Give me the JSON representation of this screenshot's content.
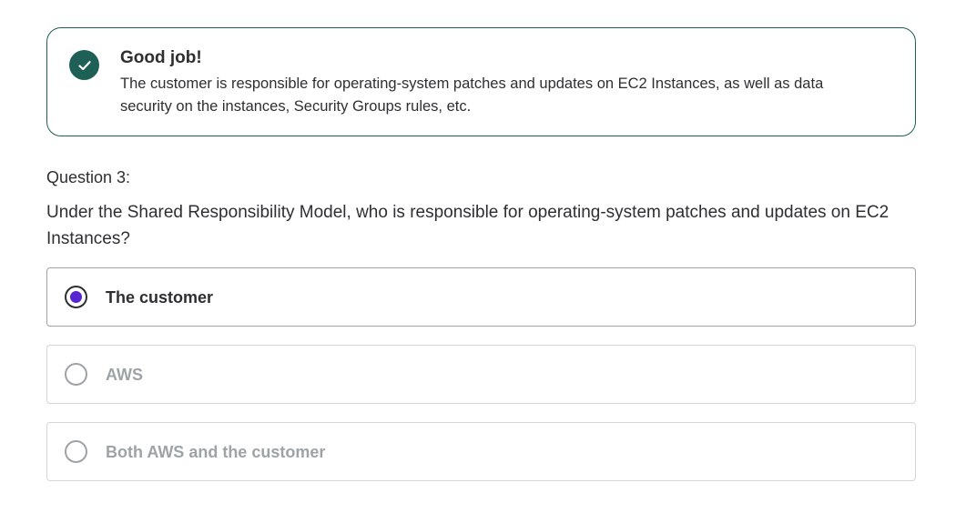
{
  "feedback": {
    "status_icon": "check-icon",
    "title": "Good job!",
    "message": "The customer is responsible for operating-system patches and updates on EC2 Instances, as well as data security on the instances, Security Groups rules, etc.",
    "color": "#1e6055"
  },
  "question": {
    "label": "Question 3:",
    "prompt": "Under the Shared Responsibility Model, who is responsible for operating-system patches and updates on EC2 Instances?"
  },
  "options": [
    {
      "label": "The customer",
      "selected": true
    },
    {
      "label": "AWS",
      "selected": false
    },
    {
      "label": "Both AWS and the customer",
      "selected": false
    }
  ],
  "colors": {
    "accent": "#5624d0",
    "success": "#1e6055",
    "text": "#2d2f31",
    "disabled_text": "#9da3a7"
  }
}
